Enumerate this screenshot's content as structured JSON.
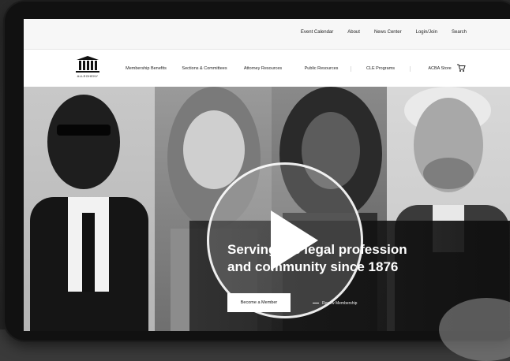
{
  "utility_nav": {
    "items": [
      "Event Calendar",
      "About",
      "News Center",
      "Login/Join",
      "Search"
    ]
  },
  "logo": {
    "name": "ALLEGHENY"
  },
  "main_nav": {
    "items": [
      {
        "label": "Membership Benefits"
      },
      {
        "label": "Sections & Committees"
      },
      {
        "label": "Attorney Resources"
      },
      {
        "label": "Public Resources"
      },
      {
        "label": "CLE Programs"
      },
      {
        "label": "ACBA Store"
      }
    ],
    "cart_icon": "cart-icon"
  },
  "hero": {
    "headline_line1": "Serving the legal profession",
    "headline_line2": "and community since 1876",
    "cta_label": "Become a Member",
    "secondary_link": "Renew Membership",
    "play_icon": "play-icon"
  }
}
